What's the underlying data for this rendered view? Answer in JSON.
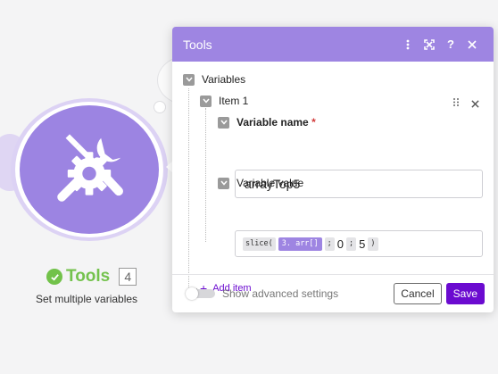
{
  "module": {
    "title": "Tools",
    "badge": "4",
    "subtitle": "Set multiple variables",
    "color": "#9c84e2",
    "status_color": "#74c24d",
    "icon": "tools-icon"
  },
  "panel": {
    "title": "Tools",
    "header_icons": [
      "more-vertical-icon",
      "expand-icon",
      "help-icon",
      "close-icon"
    ],
    "section_label": "Variables",
    "item_label": "Item 1",
    "variable_name_label": "Variable name",
    "required_mark": "*",
    "variable_name_value": "arrayTop5",
    "variable_value_label": "Variable value",
    "expression": {
      "func_open": "slice(",
      "var_token": "3. arr[]",
      "sep1": ";",
      "arg1": "0",
      "sep2": ";",
      "arg2": "5",
      "func_close": ")"
    },
    "add_item_label": "Add item",
    "advanced_label": "Show advanced settings",
    "cancel_label": "Cancel",
    "save_label": "Save",
    "accent_color": "#6b0bd0",
    "header_color": "#9e85e2"
  }
}
